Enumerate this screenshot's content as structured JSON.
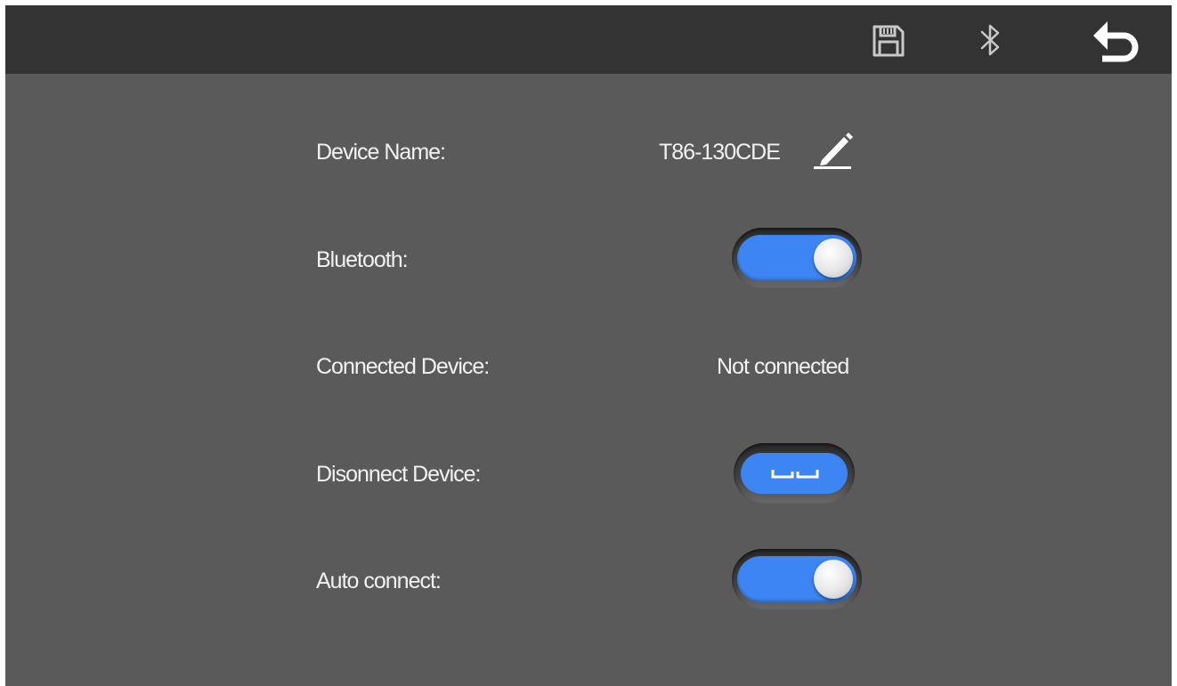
{
  "topbar": {
    "icons": [
      "save-icon",
      "bluetooth-icon",
      "back-icon"
    ],
    "bg_color": "#333333"
  },
  "settings": {
    "device_name_label": "Device Name:",
    "device_name_value": "T86-130CDE",
    "bluetooth_label": "Bluetooth:",
    "bluetooth_on": true,
    "connected_device_label": "Connected Device:",
    "connected_device_value": "Not connected",
    "disconnect_label": "Disonnect Device:",
    "auto_connect_label": "Auto connect:",
    "auto_connect_on": true
  },
  "colors": {
    "background": "#5a5a5a",
    "accent": "#3d85f2",
    "text": "#f2f2f2"
  }
}
